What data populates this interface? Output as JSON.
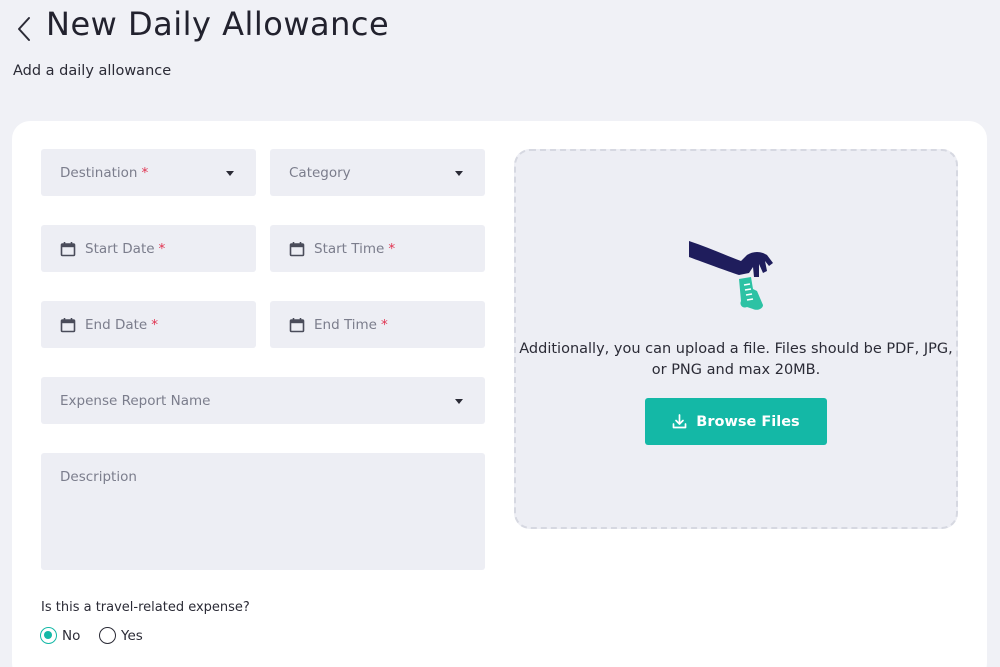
{
  "header": {
    "title": "New Daily Allowance",
    "subtitle": "Add a daily allowance"
  },
  "form": {
    "destination": {
      "label": "Destination",
      "required_mark": "*"
    },
    "category": {
      "label": "Category"
    },
    "start_date": {
      "label": "Start Date",
      "required_mark": "*"
    },
    "start_time": {
      "label": "Start Time",
      "required_mark": "*"
    },
    "end_date": {
      "label": "End Date",
      "required_mark": "*"
    },
    "end_time": {
      "label": "End Time",
      "required_mark": "*"
    },
    "expense_report": {
      "label": "Expense Report Name"
    },
    "description": {
      "label": "Description"
    },
    "travel_question": "Is this a travel-related expense?",
    "travel_options": [
      {
        "label": "No",
        "selected": true
      },
      {
        "label": "Yes",
        "selected": false
      }
    ]
  },
  "upload": {
    "instructions": "Additionally, you can upload a file. Files should be PDF, JPG, or PNG and max 20MB.",
    "button_label": "Browse Files",
    "icon": "download-icon"
  },
  "colors": {
    "accent": "#14b8a6",
    "required": "#e0324f",
    "background": "#f0f1f6",
    "field": "#edeef4"
  }
}
